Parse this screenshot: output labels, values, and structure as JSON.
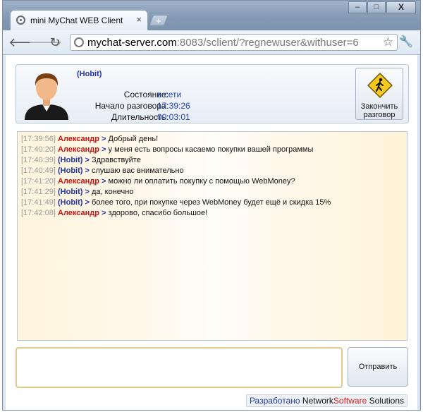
{
  "browser": {
    "tab_title": "mini MyChat WEB Client",
    "tab_close": "×",
    "new_tab": "+",
    "window_minimize": "–",
    "window_maximize": "□",
    "window_close": "X",
    "url_host": "mychat-server.com",
    "url_rest": ":8083/sclient/?regnewuser&withuser=6"
  },
  "header": {
    "username": "(Hobit)",
    "status_label": "Состояние:",
    "status_value": "в сети",
    "start_label": "Начало разговора:",
    "start_value": "17:39:26",
    "duration_label": "Длительность:",
    "duration_value": "00:03:01",
    "end_button_line1": "Закончить",
    "end_button_line2": "разговор"
  },
  "messages": [
    {
      "time": "[17:39:56]",
      "author": "Александр",
      "kind": "remote",
      "text": "Добрый день!"
    },
    {
      "time": "[17:40:20]",
      "author": "Александр",
      "kind": "remote",
      "text": "у меня есть вопросы касаемо покупки вашей программы"
    },
    {
      "time": "[17:40:39]",
      "author": "(Hobit)",
      "kind": "local",
      "text": "Здравствуйте"
    },
    {
      "time": "[17:40:49]",
      "author": "(Hobit)",
      "kind": "local",
      "text": "слушаю вас внимательно"
    },
    {
      "time": "[17:41:20]",
      "author": "Александр",
      "kind": "remote",
      "text": "можно ли оплатить покупку с помощью WebMoney?"
    },
    {
      "time": "[17:41:29]",
      "author": "(Hobit)",
      "kind": "local",
      "text": "да, конечно"
    },
    {
      "time": "[17:41:49]",
      "author": "(Hobit)",
      "kind": "local",
      "text": "более того, при покупке через WebMoney будет ещё и скидка 15%"
    },
    {
      "time": "[17:42:08]",
      "author": "Александр",
      "kind": "remote",
      "text": "здорово, спасибо большое!"
    }
  ],
  "message_arrow": ">",
  "compose": {
    "value": "",
    "send_label": "Отправить"
  },
  "footer": {
    "part1": "Разработано",
    "part2": "Network",
    "part3": "Software",
    "part4": "Solutions"
  },
  "colors": {
    "remote_author": "#cc1111",
    "local_author": "#2233aa",
    "timestamp": "#9a9a9a",
    "value_blue": "#2244bb"
  }
}
